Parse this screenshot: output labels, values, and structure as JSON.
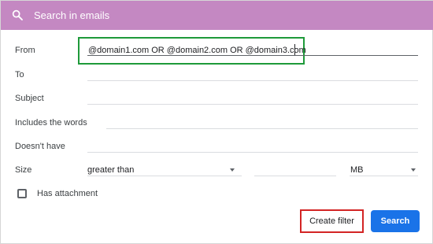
{
  "search": {
    "placeholder": "Search in emails",
    "icon": "search-icon"
  },
  "filter_form": {
    "from": {
      "label": "From",
      "value": "@domain1.com OR @domain2.com OR @domain3.com"
    },
    "to": {
      "label": "To",
      "value": ""
    },
    "subject": {
      "label": "Subject",
      "value": ""
    },
    "includes_words": {
      "label": "Includes the words",
      "value": ""
    },
    "doesnt_have": {
      "label": "Doesn't have",
      "value": ""
    },
    "size": {
      "label": "Size",
      "operator": "greater than",
      "value": "",
      "unit": "MB"
    },
    "has_attachment": {
      "label": "Has attachment",
      "checked": false
    }
  },
  "actions": {
    "create_filter": "Create filter",
    "search": "Search"
  },
  "colors": {
    "header_bg": "#c488c2",
    "primary_button": "#1a73e8",
    "from_highlight": "#1e9a3a",
    "create_filter_highlight": "#d32424"
  }
}
